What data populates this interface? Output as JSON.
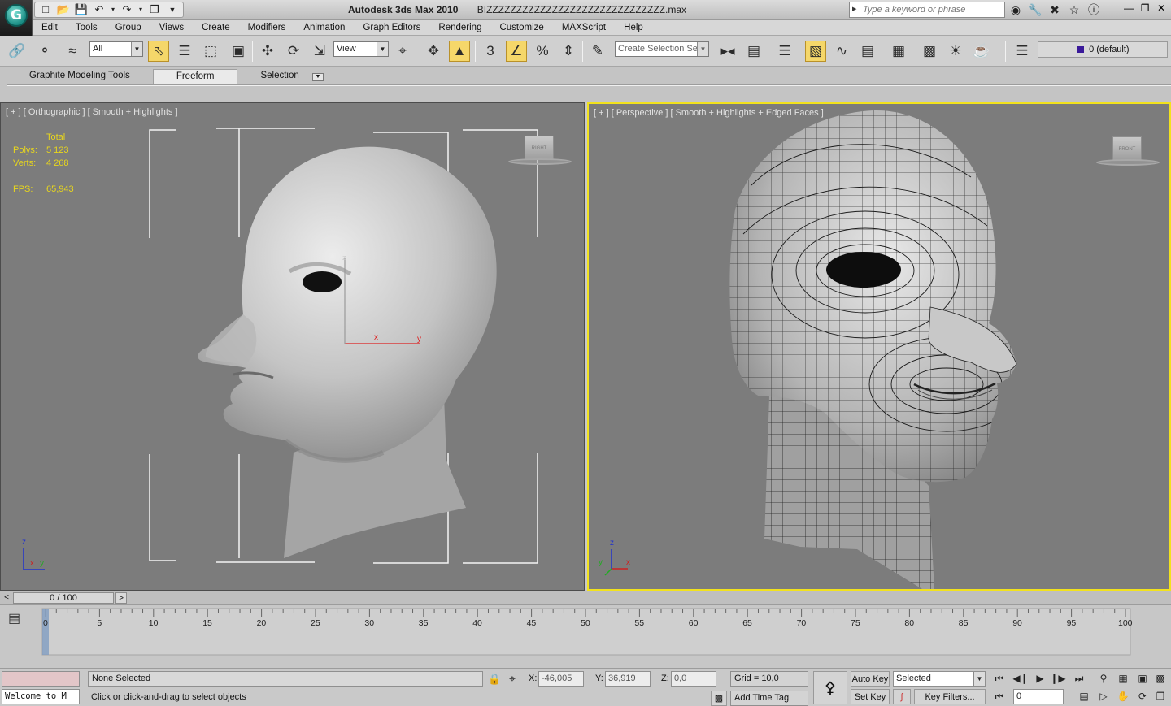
{
  "window": {
    "title": "Autodesk 3ds Max  2010",
    "filename": "BIZZZZZZZZZZZZZZZZZZZZZZZZZZZZZZ.max",
    "search_placeholder": "Type a keyword or phrase"
  },
  "menu": [
    "Edit",
    "Tools",
    "Group",
    "Views",
    "Create",
    "Modifiers",
    "Animation",
    "Graph Editors",
    "Rendering",
    "Customize",
    "MAXScript",
    "Help"
  ],
  "toolbar": {
    "filter_value": "All",
    "reference_coord": "View",
    "named_selection_placeholder": "Create Selection Se",
    "layer": "0 (default)",
    "snap_label": "3"
  },
  "ribbon": {
    "tabs": [
      "Graphite Modeling Tools",
      "Freeform",
      "Selection"
    ],
    "active_tab": "Freeform"
  },
  "viewports": {
    "left": {
      "label": "[ + ] [ Orthographic ] [ Smooth + Highlights ]",
      "stats": {
        "header": "Total",
        "polys_label": "Polys:",
        "polys": "5 123",
        "verts_label": "Verts:",
        "verts": "4 268",
        "fps_label": "FPS:",
        "fps": "65,943"
      },
      "viewcube_label": "RIGHT"
    },
    "right": {
      "label": "[ + ] [ Perspective ] [ Smooth + Highlights + Edged Faces ]",
      "viewcube_label": "FRONT"
    },
    "axis": {
      "z": "z",
      "x": "x",
      "y": "y"
    }
  },
  "timeline": {
    "frame_display": "0 / 100",
    "ticks": [
      "0",
      "5",
      "10",
      "15",
      "20",
      "25",
      "30",
      "35",
      "40",
      "45",
      "50",
      "55",
      "60",
      "65",
      "70",
      "75",
      "80",
      "85",
      "90",
      "95",
      "100"
    ]
  },
  "status": {
    "welcome": "Welcome to M",
    "selection": "None Selected",
    "prompt": "Click or click-and-drag to select objects",
    "x_label": "X:",
    "x_value": "-46,005",
    "y_label": "Y:",
    "y_value": "36,919",
    "z_label": "Z:",
    "z_value": "0,0",
    "grid": "Grid = 10,0",
    "add_time_tag": "Add Time Tag",
    "auto_key": "Auto Key",
    "set_key": "Set Key",
    "key_mode": "Selected",
    "key_filters": "Key Filters...",
    "current_frame": "0"
  },
  "colors": {
    "active_viewport_border": "#f2e21d",
    "stats_text": "#e8d61d",
    "viewport_bg": "#7c7c7c"
  }
}
